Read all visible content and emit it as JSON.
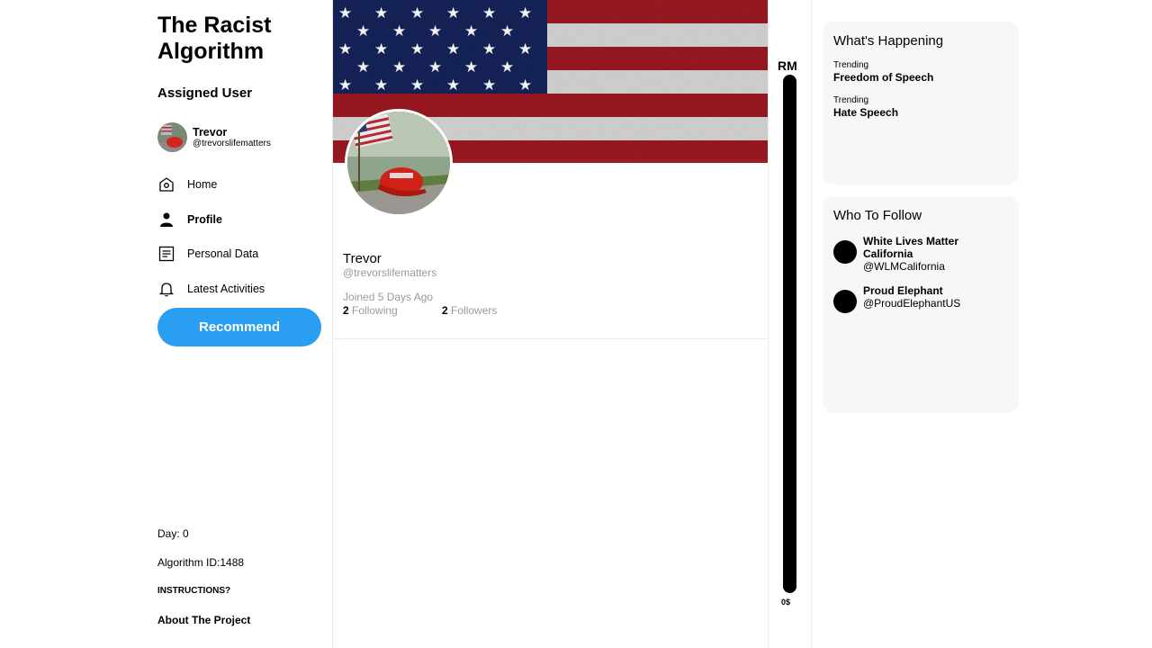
{
  "app": {
    "title": "The Racist Algorithm"
  },
  "sidebar": {
    "assigned_heading": "Assigned User",
    "user": {
      "name": "Trevor",
      "handle": "@trevorslifematters"
    },
    "nav": [
      {
        "label": "Home",
        "icon": "home-icon"
      },
      {
        "label": "Profile",
        "icon": "person-icon"
      },
      {
        "label": "Personal Data",
        "icon": "document-icon"
      },
      {
        "label": "Latest Activities",
        "icon": "bell-icon"
      }
    ],
    "recommend_label": "Recommend",
    "day": "Day: 0",
    "algorithm_id": "Algorithm ID:1488",
    "instructions": "INSTRUCTIONS?",
    "about": "About The Project"
  },
  "profile": {
    "name": "Trevor",
    "handle": "@trevorslifematters",
    "joined": "Joined 5 Days Ago",
    "following_count": "2",
    "following_label": " Following",
    "followers_count": "2",
    "followers_label": " Followers"
  },
  "meter": {
    "label": "RM",
    "bottom_label": "0$"
  },
  "happening": {
    "heading": "What's Happening",
    "trends": [
      {
        "category": "Trending",
        "topic": "Freedom of Speech"
      },
      {
        "category": "Trending",
        "topic": "Hate Speech"
      }
    ]
  },
  "who_to_follow": {
    "heading": "Who To Follow",
    "accounts": [
      {
        "name": "White Lives Matter California",
        "handle": "@WLMCalifornia"
      },
      {
        "name": "Proud Elephant",
        "handle": "@ProudElephantUS"
      }
    ]
  },
  "colors": {
    "accent": "#2a9ff1",
    "panel_bg": "#f6f7f6",
    "muted_text": "#9a9a9a"
  }
}
